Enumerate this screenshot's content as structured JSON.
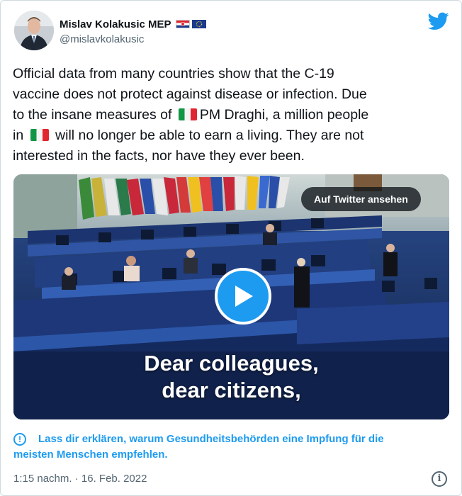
{
  "author": {
    "name": "Mislav Kolakusic MEP",
    "handle": "@mislavkolakusic",
    "avatar": "avatar-portrait",
    "badges": [
      "flag-croatia-icon",
      "flag-eu-icon"
    ]
  },
  "brand": {
    "icon": "twitter-bird-icon",
    "color": "#1d9bf0"
  },
  "tweet": {
    "line1": "Official data from many countries show that the C-19",
    "line2": "vaccine does not protect against disease or infection. Due",
    "line3a": "to the insane measures of",
    "line3b": "PM Draghi, a million people",
    "line4a": "in",
    "line4b": "will no longer be able to earn a living. They are not",
    "line5": "interested in the facts, nor have they ever been."
  },
  "media": {
    "watch_label": "Auf Twitter ansehen",
    "play_icon": "play-icon",
    "subtitle_line1": "Dear colleagues,",
    "subtitle_line2": "dear citizens,"
  },
  "notice": {
    "icon": "info-circle-icon",
    "line1": "Lass dir erklären, warum Gesundheitsbehörden eine Impfung für die",
    "line2": "meisten Menschen empfehlen."
  },
  "footer": {
    "timestamp": "1:15 nachm. · 16. Feb. 2022",
    "info_icon": "info-icon"
  },
  "colors": {
    "text": "#0f1419",
    "secondary": "#536471",
    "accent": "#1d9bf0",
    "border": "#cfd9de"
  }
}
